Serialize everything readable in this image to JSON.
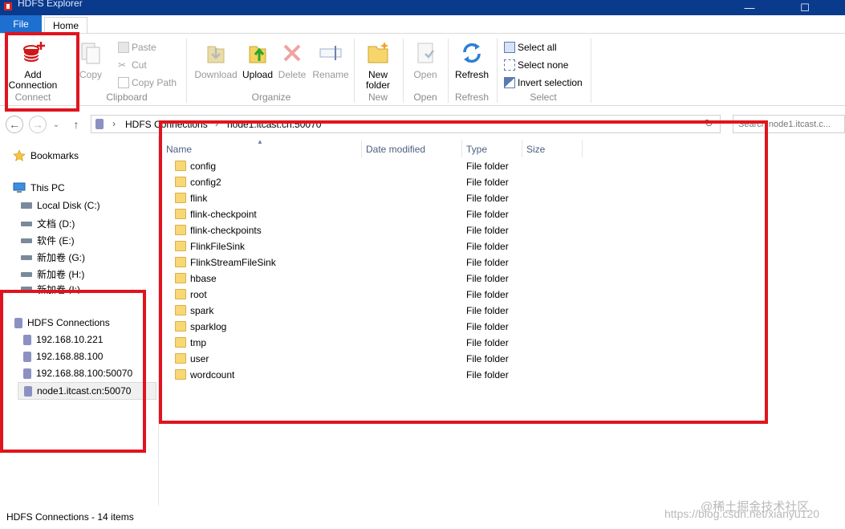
{
  "window": {
    "title": "HDFS Explorer"
  },
  "tabs": {
    "file": "File",
    "home": "Home"
  },
  "ribbon": {
    "connect": {
      "add_connection": "Add\nConnection",
      "group": "Connect"
    },
    "clipboard": {
      "copy": "Copy",
      "paste": "Paste",
      "cut": "Cut",
      "copy_path": "Copy Path",
      "group": "Clipboard"
    },
    "organize": {
      "download": "Download",
      "upload": "Upload",
      "delete": "Delete",
      "rename": "Rename",
      "group": "Organize"
    },
    "new": {
      "new_folder": "New\nfolder",
      "group": "New"
    },
    "open": {
      "open": "Open",
      "group": "Open"
    },
    "refresh": {
      "refresh": "Refresh",
      "group": "Refresh"
    },
    "select": {
      "select_all": "Select all",
      "select_none": "Select none",
      "invert_selection": "Invert selection",
      "group": "Select"
    }
  },
  "address": {
    "crumb1": "HDFS Connections",
    "crumb2": "node1.itcast.cn:50070"
  },
  "search": {
    "placeholder": "Search node1.itcast.c..."
  },
  "sidebar": {
    "bookmarks": "Bookmarks",
    "this_pc": "This PC",
    "drives": [
      "Local Disk (C:)",
      "文档 (D:)",
      "软件 (E:)",
      "新加卷 (G:)",
      "新加卷 (H:)",
      "新加卷 (I:)"
    ],
    "hdfs_connections": "HDFS Connections",
    "connections": [
      "192.168.10.221",
      "192.168.88.100",
      "192.168.88.100:50070",
      "node1.itcast.cn:50070"
    ]
  },
  "columns": {
    "name": "Name",
    "date_modified": "Date modified",
    "type": "Type",
    "size": "Size"
  },
  "files": [
    {
      "name": "config",
      "type": "File folder"
    },
    {
      "name": "config2",
      "type": "File folder"
    },
    {
      "name": "flink",
      "type": "File folder"
    },
    {
      "name": "flink-checkpoint",
      "type": "File folder"
    },
    {
      "name": "flink-checkpoints",
      "type": "File folder"
    },
    {
      "name": "FlinkFileSink",
      "type": "File folder"
    },
    {
      "name": "FlinkStreamFileSink",
      "type": "File folder"
    },
    {
      "name": "hbase",
      "type": "File folder"
    },
    {
      "name": "root",
      "type": "File folder"
    },
    {
      "name": "spark",
      "type": "File folder"
    },
    {
      "name": "sparklog",
      "type": "File folder"
    },
    {
      "name": "tmp",
      "type": "File folder"
    },
    {
      "name": "user",
      "type": "File folder"
    },
    {
      "name": "wordcount",
      "type": "File folder"
    }
  ],
  "status": {
    "text": "HDFS Connections - 14 items"
  },
  "watermark": {
    "logo_text": "@稀土掘金技术社区",
    "url": "https://blog.csdn.net/xianyu120"
  },
  "colors": {
    "accent": "#1d6fd0",
    "title_bar": "#0a3a8c",
    "highlight": "#e0141e",
    "folder": "#f8d775"
  }
}
